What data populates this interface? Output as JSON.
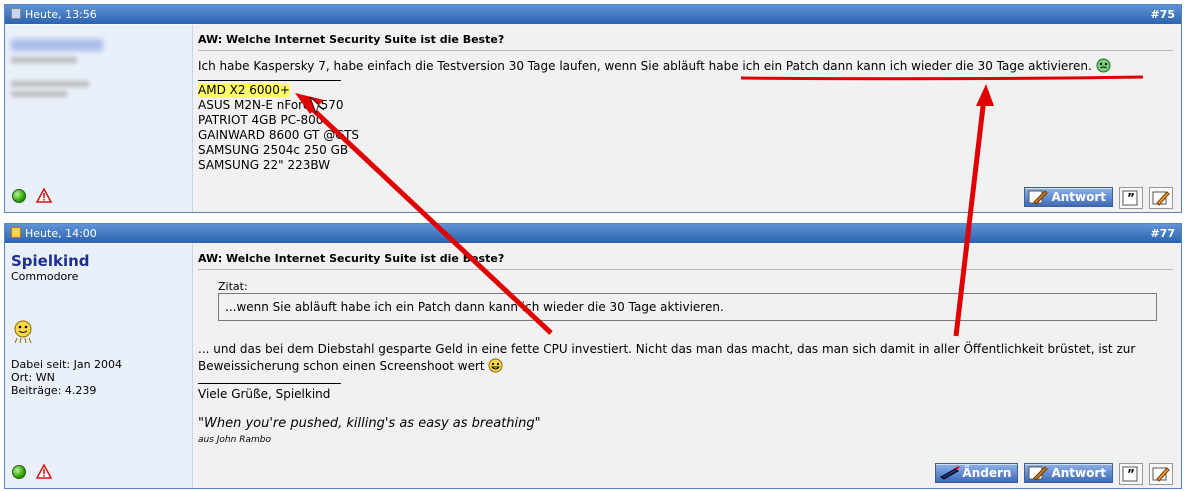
{
  "posts": [
    {
      "date": "Heute, 13:56",
      "number": "#75",
      "title": "AW: Welche Internet Security Suite ist die Beste?",
      "text_before": "Ich habe Kaspersky 7, habe einfach die Testversion 30 Tage laufen, wenn Sie abläuft ",
      "text_underlined": "habe ich ein Patch dann kann ich wieder die 30 Tage aktivieren.",
      "signature": {
        "highlighted": "AMD X2 6000+",
        "lines": [
          "ASUS M2N-E nForce 570",
          "PATRIOT 4GB PC-800",
          "GAINWARD 8600 GT @GTS",
          "SAMSUNG 2504c 250 GB",
          "SAMSUNG 22\" 223BW"
        ]
      },
      "buttons": {
        "reply": "Antwort"
      }
    },
    {
      "date": "Heute, 14:00",
      "number": "#77",
      "username": "Spielkind",
      "rank": "Commodore",
      "userinfo": {
        "joined": "Dabei seit: Jan 2004",
        "location": "Ort: WN",
        "posts": "Beiträge: 4.239"
      },
      "title": "AW: Welche Internet Security Suite ist die Beste?",
      "quote_label": "Zitat:",
      "quote_text": "...wenn Sie abläuft habe ich ein Patch dann kann ich wieder die 30 Tage aktivieren.",
      "reply_text": "... und das bei dem Diebstahl gesparte Geld in eine fette CPU investiert. Nicht das man das macht, das man sich damit in aller Öffentlichkeit brüstet, ist zur Beweissicherung schon einen Screenshoot wert",
      "greeting": "Viele Grüße, Spielkind",
      "sig_quote": "\"When you're pushed, killing's as easy as breathing\"",
      "sig_source": "aus John Rambo",
      "buttons": {
        "edit": "Ändern",
        "reply": "Antwort"
      }
    }
  ],
  "colors": {
    "header": "#2c63b0",
    "annotation": "#e00000",
    "highlight": "#ffff66"
  }
}
